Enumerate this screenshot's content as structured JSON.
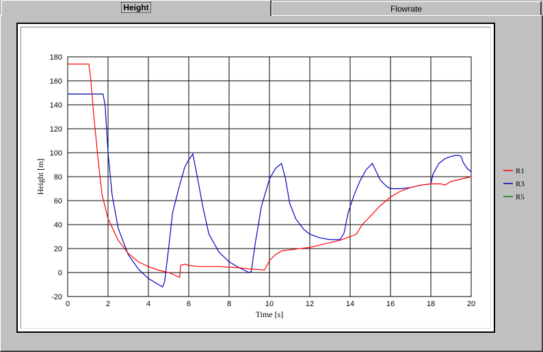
{
  "tabs": [
    {
      "label": "Height",
      "active": true
    },
    {
      "label": "Flowrate",
      "active": false
    }
  ],
  "chart_data": {
    "type": "line",
    "xlabel": "Time [s]",
    "ylabel": "Height [m]",
    "xlim": [
      0,
      20
    ],
    "ylim": [
      -20,
      180
    ],
    "xticks": [
      0,
      2,
      4,
      6,
      8,
      10,
      12,
      14,
      16,
      18,
      20
    ],
    "yticks": [
      -20,
      0,
      20,
      40,
      60,
      80,
      100,
      120,
      140,
      160,
      180
    ],
    "grid": true,
    "legend_position": "right",
    "series": [
      {
        "name": "R1",
        "color": "#ff0000",
        "points": [
          [
            0,
            174
          ],
          [
            1.05,
            174
          ],
          [
            1.15,
            160
          ],
          [
            1.3,
            130
          ],
          [
            1.5,
            95
          ],
          [
            1.7,
            65
          ],
          [
            2,
            45
          ],
          [
            2.5,
            27
          ],
          [
            3,
            16
          ],
          [
            3.5,
            9
          ],
          [
            4,
            5
          ],
          [
            4.5,
            2
          ],
          [
            5,
            0
          ],
          [
            5.3,
            -2
          ],
          [
            5.4,
            -3
          ],
          [
            5.55,
            -4
          ],
          [
            5.6,
            6
          ],
          [
            5.8,
            7
          ],
          [
            6,
            6
          ],
          [
            6.5,
            5
          ],
          [
            7,
            5
          ],
          [
            7.5,
            5
          ],
          [
            8,
            4.5
          ],
          [
            8.5,
            4
          ],
          [
            9,
            3
          ],
          [
            9.5,
            2.5
          ],
          [
            9.75,
            2
          ],
          [
            9.85,
            5
          ],
          [
            10,
            10
          ],
          [
            10.3,
            15
          ],
          [
            10.6,
            18
          ],
          [
            11,
            19
          ],
          [
            11.5,
            20
          ],
          [
            12,
            21
          ],
          [
            12.5,
            23
          ],
          [
            13,
            25
          ],
          [
            13.5,
            27
          ],
          [
            14,
            30
          ],
          [
            14.3,
            32
          ],
          [
            14.6,
            40
          ],
          [
            15,
            47
          ],
          [
            15.5,
            56
          ],
          [
            16,
            63
          ],
          [
            16.5,
            68
          ],
          [
            17,
            71
          ],
          [
            17.5,
            73
          ],
          [
            18,
            74
          ],
          [
            18.5,
            74
          ],
          [
            18.7,
            73
          ],
          [
            19,
            76
          ],
          [
            19.5,
            78
          ],
          [
            20,
            80
          ]
        ]
      },
      {
        "name": "R3",
        "color": "#0000c0",
        "points": [
          [
            0,
            149
          ],
          [
            1.75,
            149
          ],
          [
            1.85,
            140
          ],
          [
            2,
            100
          ],
          [
            2.2,
            65
          ],
          [
            2.5,
            37
          ],
          [
            3,
            15
          ],
          [
            3.5,
            3
          ],
          [
            4,
            -5
          ],
          [
            4.5,
            -10
          ],
          [
            4.7,
            -12
          ],
          [
            4.8,
            -8
          ],
          [
            5,
            20
          ],
          [
            5.2,
            50
          ],
          [
            5.5,
            70
          ],
          [
            5.8,
            88
          ],
          [
            6,
            94
          ],
          [
            6.2,
            99
          ],
          [
            6.4,
            82
          ],
          [
            6.7,
            55
          ],
          [
            7,
            32
          ],
          [
            7.5,
            17
          ],
          [
            8,
            9
          ],
          [
            8.5,
            4
          ],
          [
            9,
            0
          ],
          [
            9.1,
            1
          ],
          [
            9.3,
            25
          ],
          [
            9.6,
            55
          ],
          [
            10,
            78
          ],
          [
            10.3,
            87
          ],
          [
            10.6,
            91
          ],
          [
            10.8,
            78
          ],
          [
            11,
            58
          ],
          [
            11.3,
            45
          ],
          [
            11.7,
            36
          ],
          [
            12,
            32
          ],
          [
            12.5,
            29
          ],
          [
            13,
            27.5
          ],
          [
            13.5,
            27.5
          ],
          [
            13.7,
            33
          ],
          [
            13.9,
            50
          ],
          [
            14.2,
            65
          ],
          [
            14.5,
            77
          ],
          [
            14.8,
            86
          ],
          [
            15.1,
            91
          ],
          [
            15.3,
            84
          ],
          [
            15.5,
            77
          ],
          [
            15.8,
            72
          ],
          [
            16,
            70
          ],
          [
            16.5,
            70
          ],
          [
            17,
            71
          ],
          [
            17.5,
            73
          ],
          [
            18,
            74
          ],
          [
            18.1,
            82
          ],
          [
            18.4,
            91
          ],
          [
            18.7,
            95
          ],
          [
            19,
            97
          ],
          [
            19.3,
            98
          ],
          [
            19.5,
            97
          ],
          [
            19.6,
            92
          ],
          [
            19.8,
            87
          ],
          [
            20,
            84
          ]
        ]
      },
      {
        "name": "R5",
        "color": "#008000",
        "points": [
          [
            0,
            149
          ],
          [
            1.78,
            149
          ]
        ]
      }
    ]
  }
}
